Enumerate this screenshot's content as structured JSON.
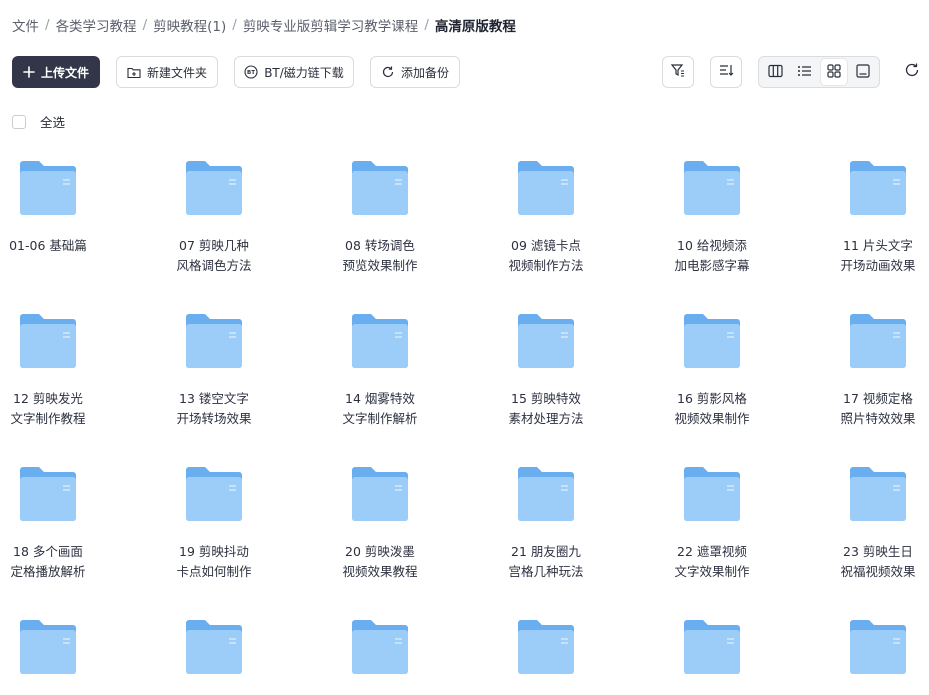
{
  "breadcrumb": {
    "items": [
      "文件",
      "各类学习教程",
      "剪映教程(1)",
      "剪映专业版剪辑学习教学课程"
    ],
    "current": "高清原版教程",
    "separator": "/"
  },
  "toolbar": {
    "upload_label": "上传文件",
    "new_folder_label": "新建文件夹",
    "bt_label": "BT/磁力链下载",
    "backup_label": "添加备份"
  },
  "select_all_label": "全选",
  "folders": [
    {
      "line1": "01-06 基础篇",
      "line2": ""
    },
    {
      "line1": "07 剪映几种",
      "line2": "风格调色方法"
    },
    {
      "line1": "08 转场调色",
      "line2": "预览效果制作"
    },
    {
      "line1": "09 滤镜卡点",
      "line2": "视频制作方法"
    },
    {
      "line1": "10 给视频添",
      "line2": "加电影感字幕"
    },
    {
      "line1": "11 片头文字",
      "line2": "开场动画效果"
    },
    {
      "line1": "12 剪映发光",
      "line2": "文字制作教程"
    },
    {
      "line1": "13 镂空文字",
      "line2": "开场转场效果"
    },
    {
      "line1": "14 烟雾特效",
      "line2": "文字制作解析"
    },
    {
      "line1": "15 剪映特效",
      "line2": "素材处理方法"
    },
    {
      "line1": "16 剪影风格",
      "line2": "视频效果制作"
    },
    {
      "line1": "17 视频定格",
      "line2": "照片特效效果"
    },
    {
      "line1": "18 多个画面",
      "line2": "定格播放解析"
    },
    {
      "line1": "19 剪映抖动",
      "line2": "卡点如何制作"
    },
    {
      "line1": "20 剪映泼墨",
      "line2": "视频效果教程"
    },
    {
      "line1": "21 朋友圈九",
      "line2": "宫格几种玩法"
    },
    {
      "line1": "22 遮罩视频",
      "line2": "文字效果制作"
    },
    {
      "line1": "23 剪映生日",
      "line2": "祝福视频效果"
    },
    {
      "line1": "",
      "line2": ""
    },
    {
      "line1": "",
      "line2": ""
    },
    {
      "line1": "",
      "line2": ""
    },
    {
      "line1": "",
      "line2": ""
    },
    {
      "line1": "",
      "line2": ""
    },
    {
      "line1": "",
      "line2": ""
    }
  ],
  "colors": {
    "folder_back": "#6aaef0",
    "folder_front": "#9ccdf8",
    "primary_button": "#333649"
  }
}
